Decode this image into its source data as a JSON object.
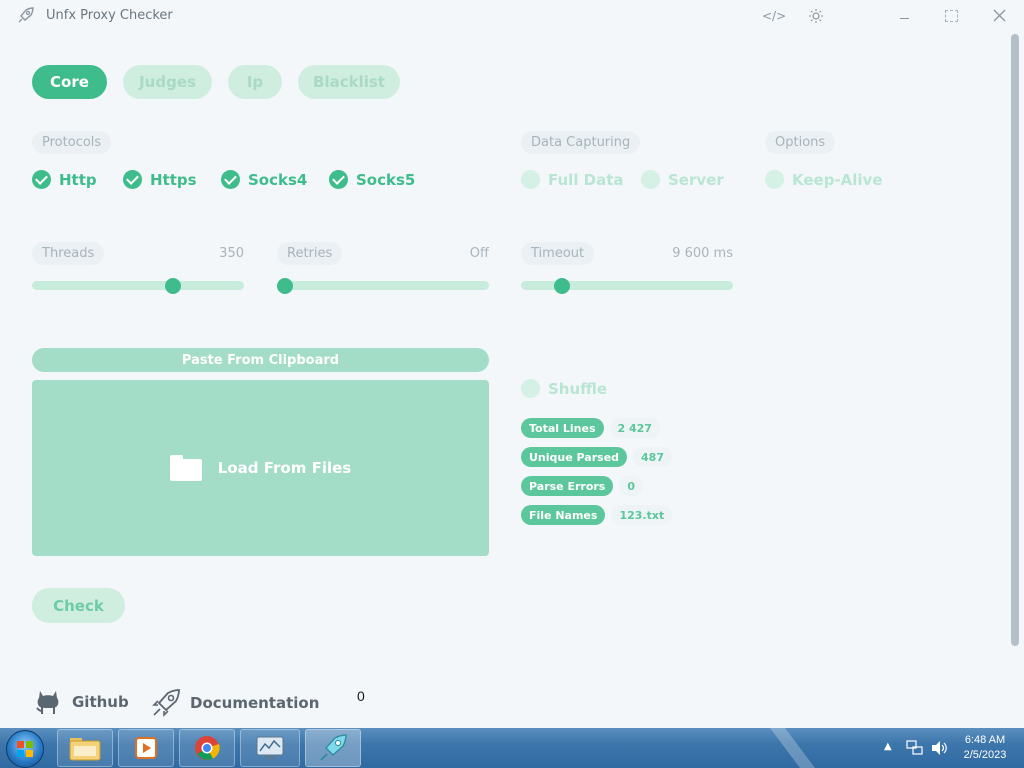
{
  "app": {
    "title": "Unfx Proxy Checker",
    "icons": [
      "rocket-icon",
      "code-icon",
      "sun-icon",
      "minimize-icon",
      "maximize-icon",
      "close-icon"
    ]
  },
  "tabs": [
    {
      "label": "Core",
      "active": true
    },
    {
      "label": "Judges",
      "active": false
    },
    {
      "label": "Ip",
      "active": false
    },
    {
      "label": "Blacklist",
      "active": false
    }
  ],
  "protocols": {
    "label": "Protocols",
    "items": [
      {
        "label": "Http",
        "checked": true
      },
      {
        "label": "Https",
        "checked": true
      },
      {
        "label": "Socks4",
        "checked": true
      },
      {
        "label": "Socks5",
        "checked": true
      }
    ]
  },
  "data_capturing": {
    "label": "Data Capturing",
    "items": [
      {
        "label": "Full Data",
        "checked": false
      },
      {
        "label": "Server",
        "checked": false
      }
    ]
  },
  "options": {
    "label": "Options",
    "items": [
      {
        "label": "Keep-Alive",
        "checked": false
      }
    ]
  },
  "sliders": {
    "threads": {
      "label": "Threads",
      "value": "350",
      "level": 0.68
    },
    "retries": {
      "label": "Retries",
      "value": "Off",
      "level": 0.0
    },
    "timeout": {
      "label": "Timeout",
      "value": "9 600 ms",
      "level": 0.17
    }
  },
  "input": {
    "paste_label": "Paste From Clipboard",
    "load_label": "Load From Files",
    "shuffle_label": "Shuffle",
    "shuffle_checked": false
  },
  "stats": [
    {
      "label": "Total Lines",
      "value": "2 427"
    },
    {
      "label": "Unique Parsed",
      "value": "487"
    },
    {
      "label": "Parse Errors",
      "value": "0"
    },
    {
      "label": "File Names",
      "value": "123.txt"
    }
  ],
  "check_label": "Check",
  "footer": {
    "github_label": "Github",
    "docs_label": "Documentation",
    "counter": "0"
  },
  "taskbar": {
    "time": "6:48 AM",
    "date": "2/5/2023"
  },
  "colors": {
    "accent": "#3fbc8c",
    "accent_light": "#a3ddc7",
    "background": "#f4f7fa"
  }
}
